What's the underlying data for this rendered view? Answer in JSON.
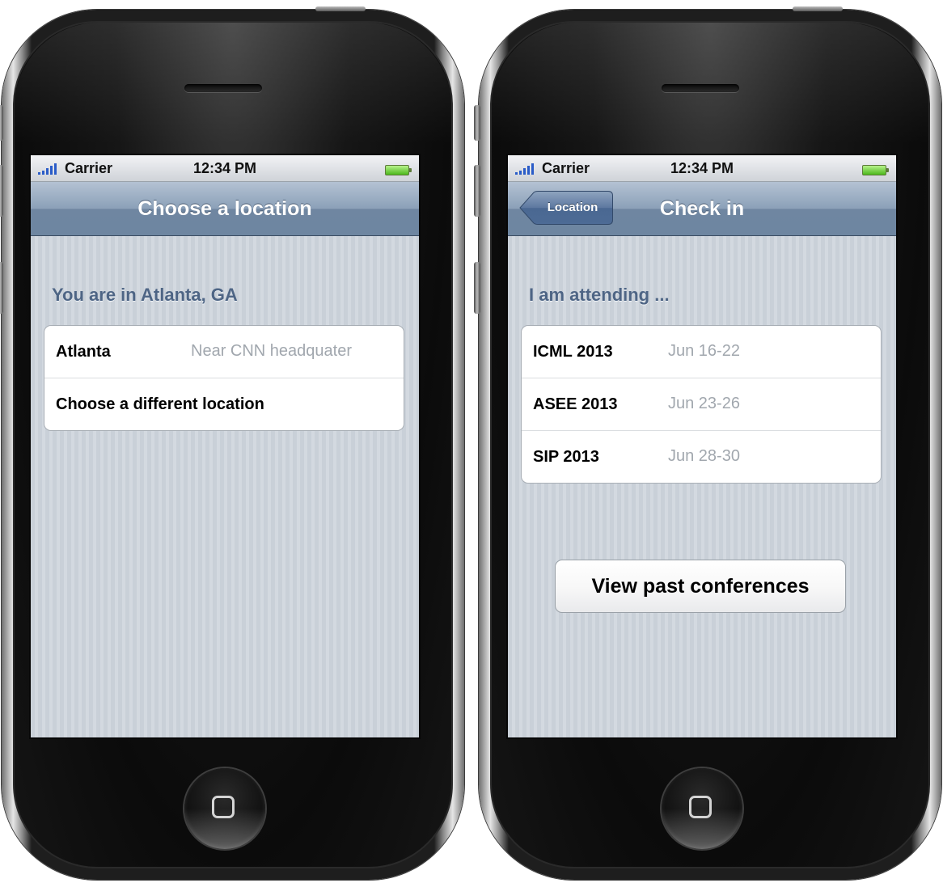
{
  "phones": [
    {
      "status": {
        "carrier": "Carrier",
        "time": "12:34 PM"
      },
      "nav": {
        "title": "Choose a location"
      },
      "section_header": "You are in Atlanta, GA",
      "rows": [
        {
          "title": "Atlanta",
          "detail": "Near CNN headquater"
        },
        {
          "title": "Choose a different location",
          "detail": ""
        }
      ]
    },
    {
      "status": {
        "carrier": "Carrier",
        "time": "12:34 PM"
      },
      "nav": {
        "title": "Check in",
        "back_label": "Location"
      },
      "section_header": "I am attending ...",
      "rows": [
        {
          "title": "ICML 2013",
          "detail": "Jun 16-22"
        },
        {
          "title": "ASEE 2013",
          "detail": "Jun 23-26"
        },
        {
          "title": "SIP 2013",
          "detail": "Jun 28-30"
        }
      ],
      "button_label": "View past conferences"
    }
  ],
  "colors": {
    "nav_bar": "#8ba0b8",
    "section_header": "#4e6585",
    "signal_bars": "#2a5cc8",
    "battery": "#4cb81c",
    "detail_text": "#a1a7ae"
  },
  "icons": [
    "signal-strength-icon",
    "battery-icon",
    "home-button-icon"
  ]
}
